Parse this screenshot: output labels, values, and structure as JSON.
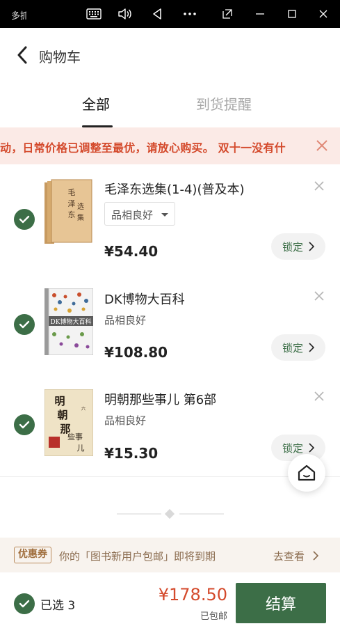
{
  "window": {
    "app_title": "多抓鱼",
    "controls": [
      "keyboard-icon",
      "volume-icon",
      "back-triangle-icon",
      "more-icon",
      "pin-icon",
      "minimize-icon",
      "maximize-icon",
      "close-icon"
    ]
  },
  "header": {
    "title": "购物车"
  },
  "tabs": [
    {
      "label": "全部",
      "active": true
    },
    {
      "label": "到货提醒",
      "active": false
    }
  ],
  "notice": {
    "text": "动，日常价格已调整至最优，请放心购买。   双十一没有什"
  },
  "items": [
    {
      "title": "毛泽东选集(1-4)(普及本)",
      "condition": "品相良好",
      "condition_dropdown": true,
      "price": "¥54.40",
      "lock_label": "锁定",
      "selected": true
    },
    {
      "title": "DK博物大百科",
      "condition": "品相良好",
      "condition_dropdown": false,
      "price": "¥108.80",
      "lock_label": "锁定",
      "selected": true
    },
    {
      "title": "明朝那些事儿 第6部",
      "condition": "品相良好",
      "condition_dropdown": false,
      "price": "¥15.30",
      "lock_label": "锁定",
      "selected": true
    }
  ],
  "coupon": {
    "badge": "优惠券",
    "text": "你的「图书新用户包邮」即将到期",
    "link": "去查看"
  },
  "checkout": {
    "selected_label": "已选 3",
    "total": "¥178.50",
    "shipping": "已包邮",
    "pay_label": "结算"
  },
  "colors": {
    "brand_green": "#3c6e47",
    "price_red": "#d44a2c",
    "notice_bg": "#fbeae6",
    "coupon_brown": "#a06e3d"
  }
}
